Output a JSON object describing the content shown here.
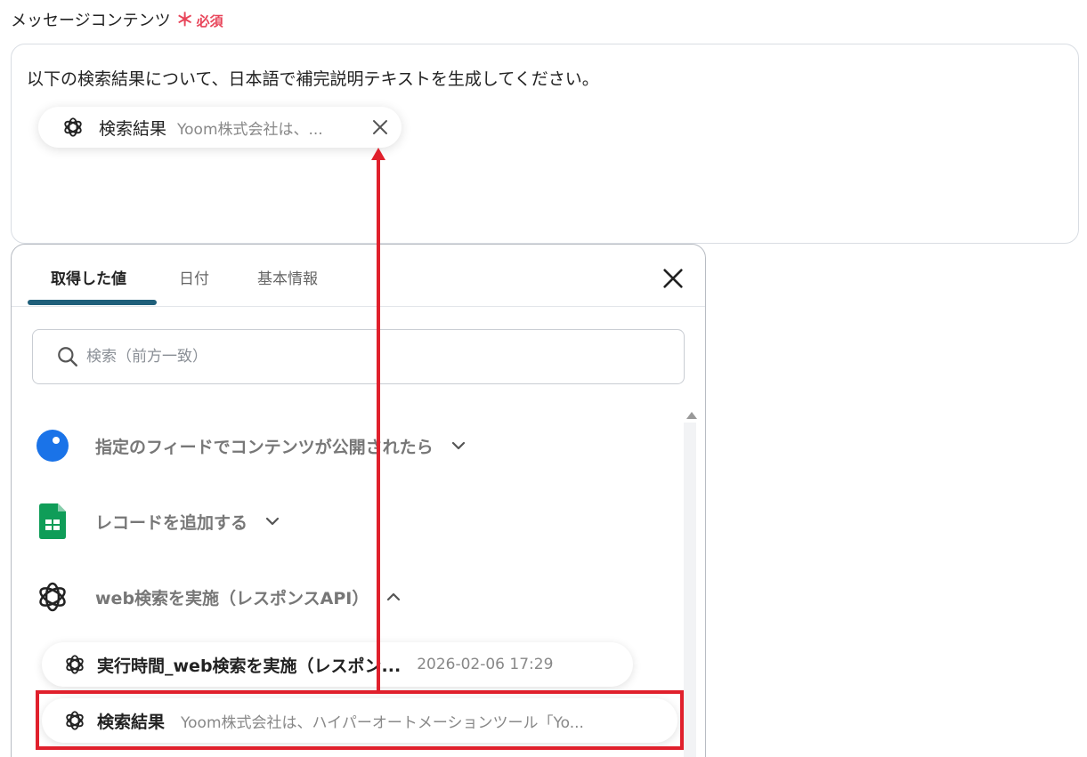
{
  "field": {
    "label": "メッセージコンテンツ",
    "required_star": "＊",
    "required_text": "必須"
  },
  "message": {
    "text": "以下の検索結果について、日本語で補完説明テキストを生成してください。",
    "chip": {
      "name": "検索結果",
      "value": "Yoom株式会社は、..."
    }
  },
  "panel": {
    "tabs": [
      {
        "label": "取得した値",
        "active": true
      },
      {
        "label": "日付",
        "active": false
      },
      {
        "label": "基本情報",
        "active": false
      }
    ],
    "search_placeholder": "検索（前方一致）",
    "groups": [
      {
        "label": "指定のフィードでコンテンツが公開されたら",
        "icon": "rss-feed-icon",
        "expanded": false
      },
      {
        "label": "レコードを追加する",
        "icon": "google-sheets-icon",
        "expanded": false
      },
      {
        "label": "web検索を実施（レスポンスAPI）",
        "icon": "openai-icon",
        "expanded": true
      }
    ],
    "items": [
      {
        "name": "実行時間_web検索を実施（レスポン...",
        "value": "2026-02-06 17:29"
      },
      {
        "name": "検索結果",
        "value": "Yoom株式会社は、ハイパーオートメーションツール「Yo..."
      }
    ]
  },
  "colors": {
    "accent": "#1f5f7a",
    "required": "#e8455a",
    "annotation": "#e0202c",
    "feed_icon": "#1a73e8",
    "sheets_icon": "#0f9d58"
  }
}
